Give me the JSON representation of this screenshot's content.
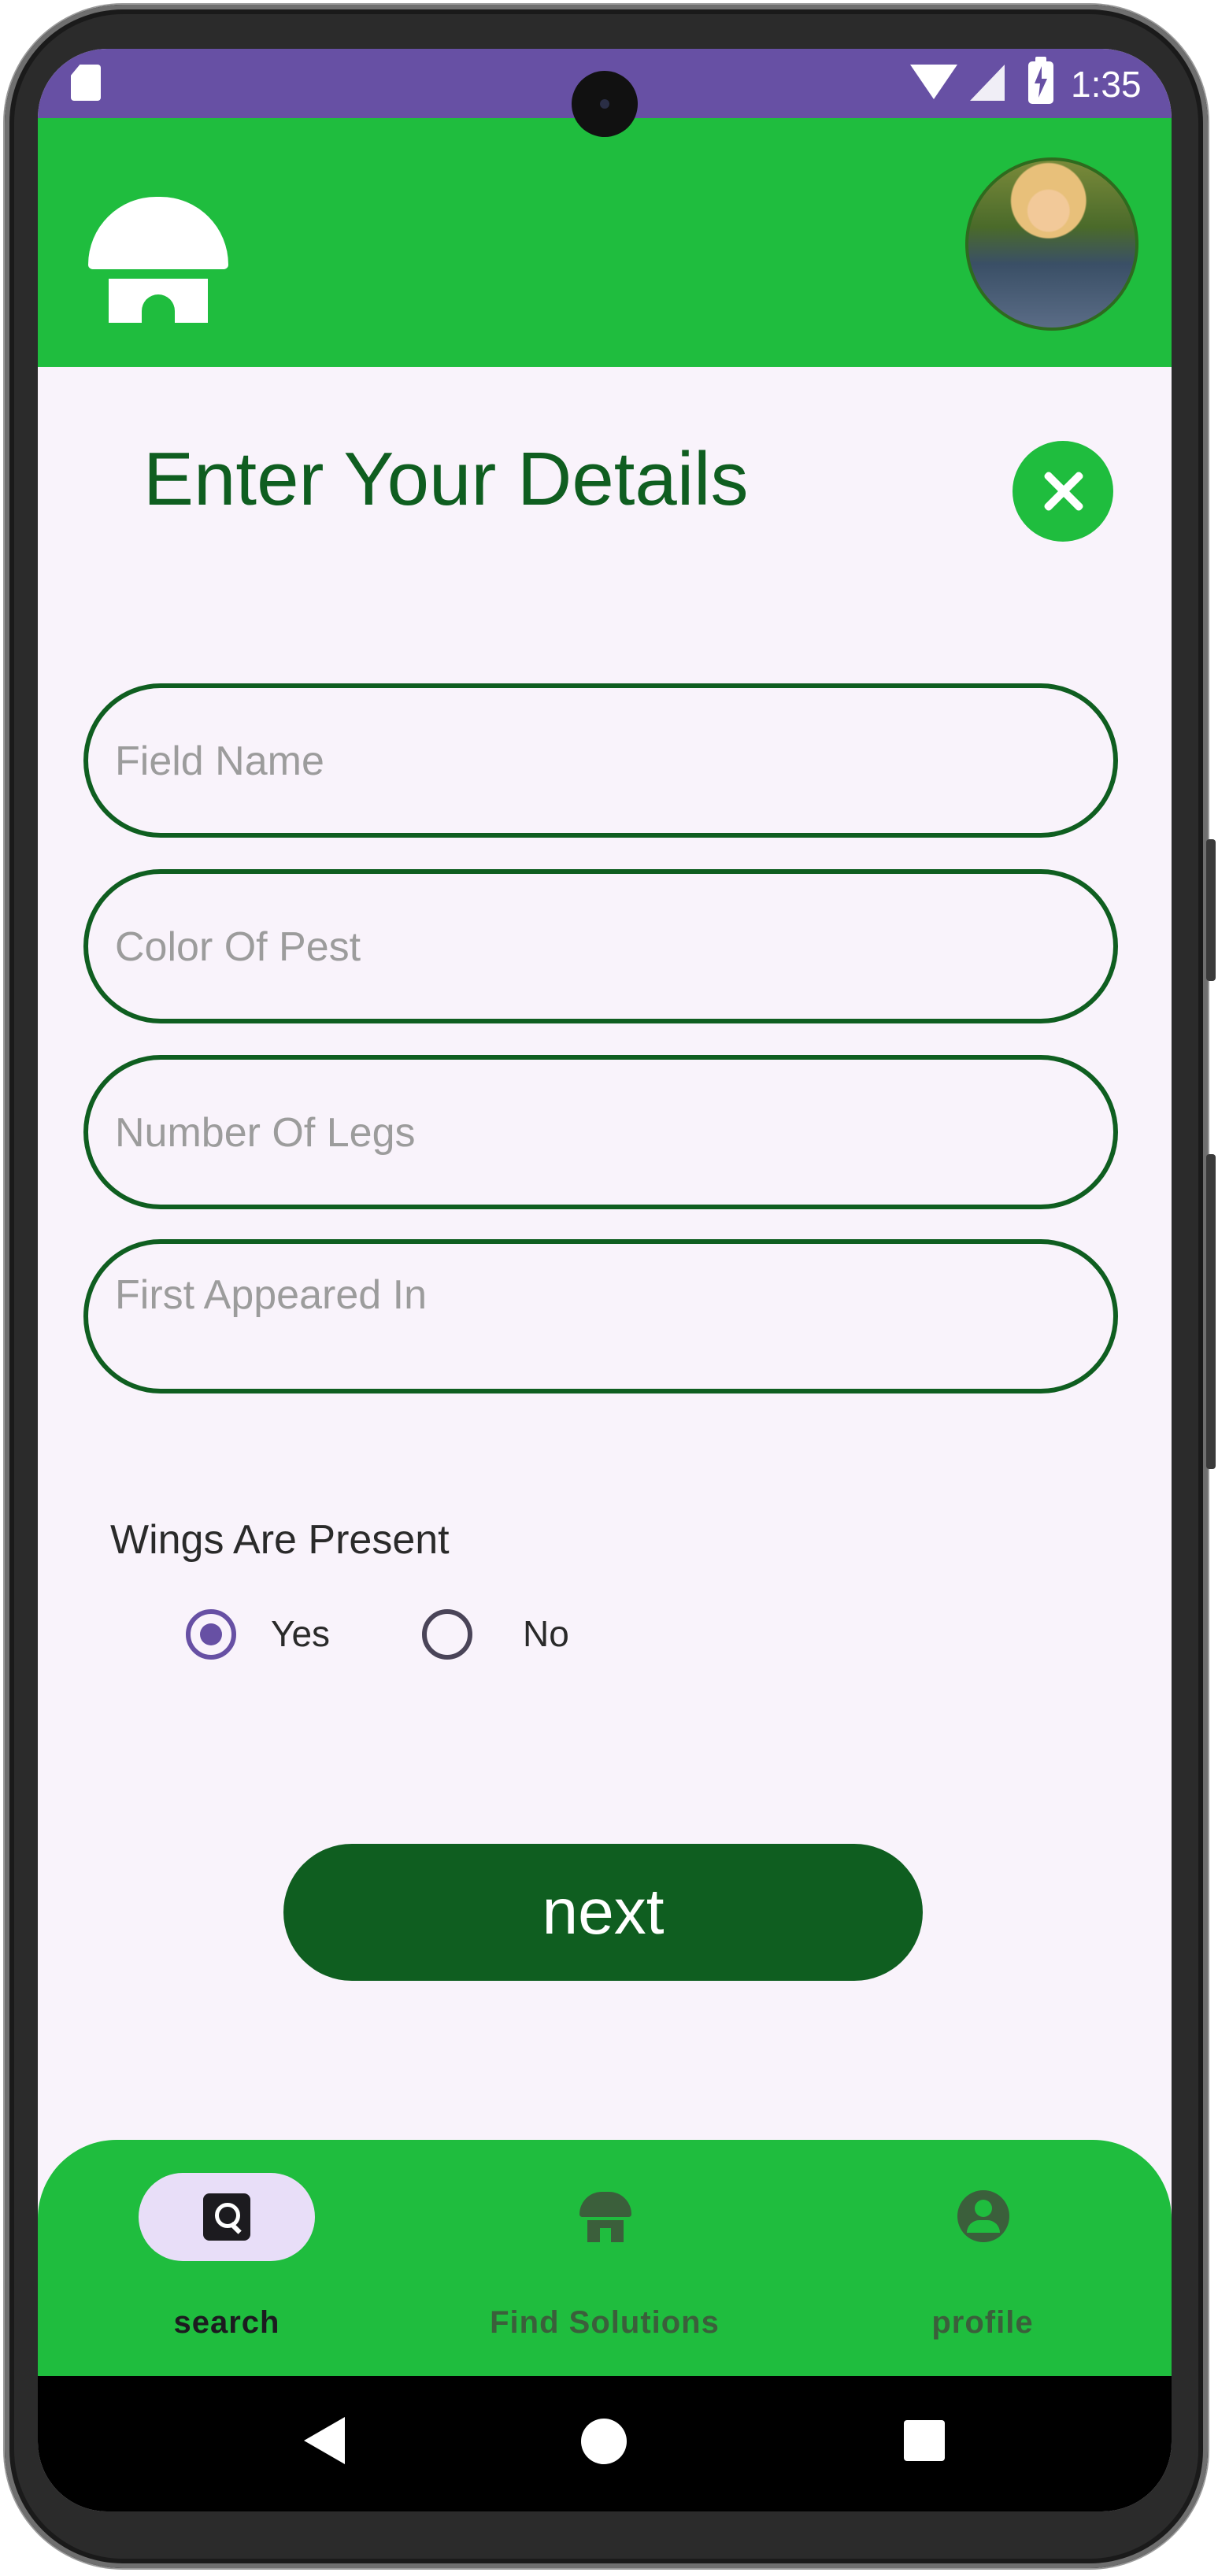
{
  "status_bar": {
    "time": "1:35",
    "icons": [
      "sd-card-icon",
      "wifi-icon",
      "signal-icon",
      "battery-charging-icon"
    ]
  },
  "header": {
    "logo_icon": "home-icon",
    "avatar_icon": "user-avatar"
  },
  "form": {
    "title": "Enter Your Details",
    "close_icon": "close-icon",
    "fields": [
      {
        "placeholder": "Field Name",
        "value": ""
      },
      {
        "placeholder": "Color Of Pest",
        "value": ""
      },
      {
        "placeholder": "Number Of Legs",
        "value": ""
      },
      {
        "placeholder": "First Appeared In",
        "value": ""
      }
    ],
    "wings_label": "Wings Are Present",
    "wings_options": [
      {
        "label": "Yes",
        "checked": true
      },
      {
        "label": "No",
        "checked": false
      }
    ],
    "next_label": "next"
  },
  "bottom_nav": {
    "items": [
      {
        "label": "search",
        "icon": "search-icon",
        "active": true
      },
      {
        "label": "Find Solutions",
        "icon": "home-icon",
        "active": false
      },
      {
        "label": "profile",
        "icon": "profile-icon",
        "active": false
      }
    ]
  },
  "system_nav": {
    "icons": [
      "back-icon",
      "home-icon",
      "recents-icon"
    ]
  },
  "colors": {
    "status_bar": "#6750a4",
    "brand_green": "#1fbd3e",
    "dark_green": "#0f5e20",
    "background": "#f9f3fb",
    "active_pill": "#e8def8"
  }
}
